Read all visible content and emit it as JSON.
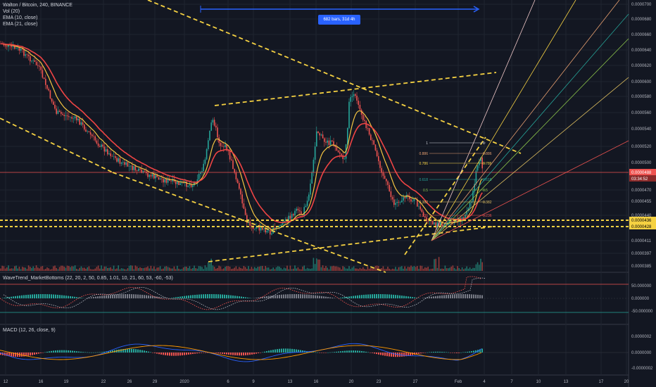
{
  "header": {
    "symbol_line": "Walton / Bitcoin, 240, BINANCE",
    "vol": "Vol (20)",
    "ema10": "EMA (10, close)",
    "ema21": "EMA (21, close)"
  },
  "measure_label": "682 bars, 31d 4h",
  "price_axis": {
    "ticks": [
      "0.0000700",
      "0.0000680",
      "0.0000660",
      "0.0000640",
      "0.0000620",
      "0.0000600",
      "0.0000580",
      "0.0000560",
      "0.0000540",
      "0.0000520",
      "0.0000500",
      "0.0000470",
      "0.0000455",
      "0.0000440",
      "0.0000411",
      "0.0000397",
      "0.0000385"
    ],
    "current_price": "0.0000488",
    "countdown": "03:34:52",
    "level_1": "0.0000436",
    "level_2": "0.0000428"
  },
  "fib_labels": [
    "1",
    "0.886",
    "0.786",
    "0.618",
    "0.5",
    "0.382",
    "0.236"
  ],
  "wavetrend": {
    "label": "WaveTrend_MarketBottoms (22, 20, 2, 50, 0.85, 1.01, 10, 21, 60, 53, -60, -53)",
    "ticks": [
      "50.000000",
      "0.000000",
      "-50.000000"
    ]
  },
  "macd": {
    "label": "MACD (12, 26, close, 9)",
    "ticks": [
      "0.0000002",
      "0.0000000",
      "-0.0000002"
    ]
  },
  "time_axis": [
    "12",
    "16",
    "19",
    "22",
    "26",
    "29",
    "2020",
    "6",
    "9",
    "13",
    "16",
    "20",
    "23",
    "27",
    "Feb",
    "4",
    "7",
    "10",
    "13",
    "17",
    "20"
  ],
  "colors": {
    "background": "#131722",
    "candle_up": "#26a69a",
    "candle_down": "#ef5350",
    "ema_fast": "#f5c542",
    "ema_slow": "#ef4444",
    "trendline": "#f5d142",
    "current_price_bg": "#ef5350",
    "measure_bg": "#2962ff"
  }
}
